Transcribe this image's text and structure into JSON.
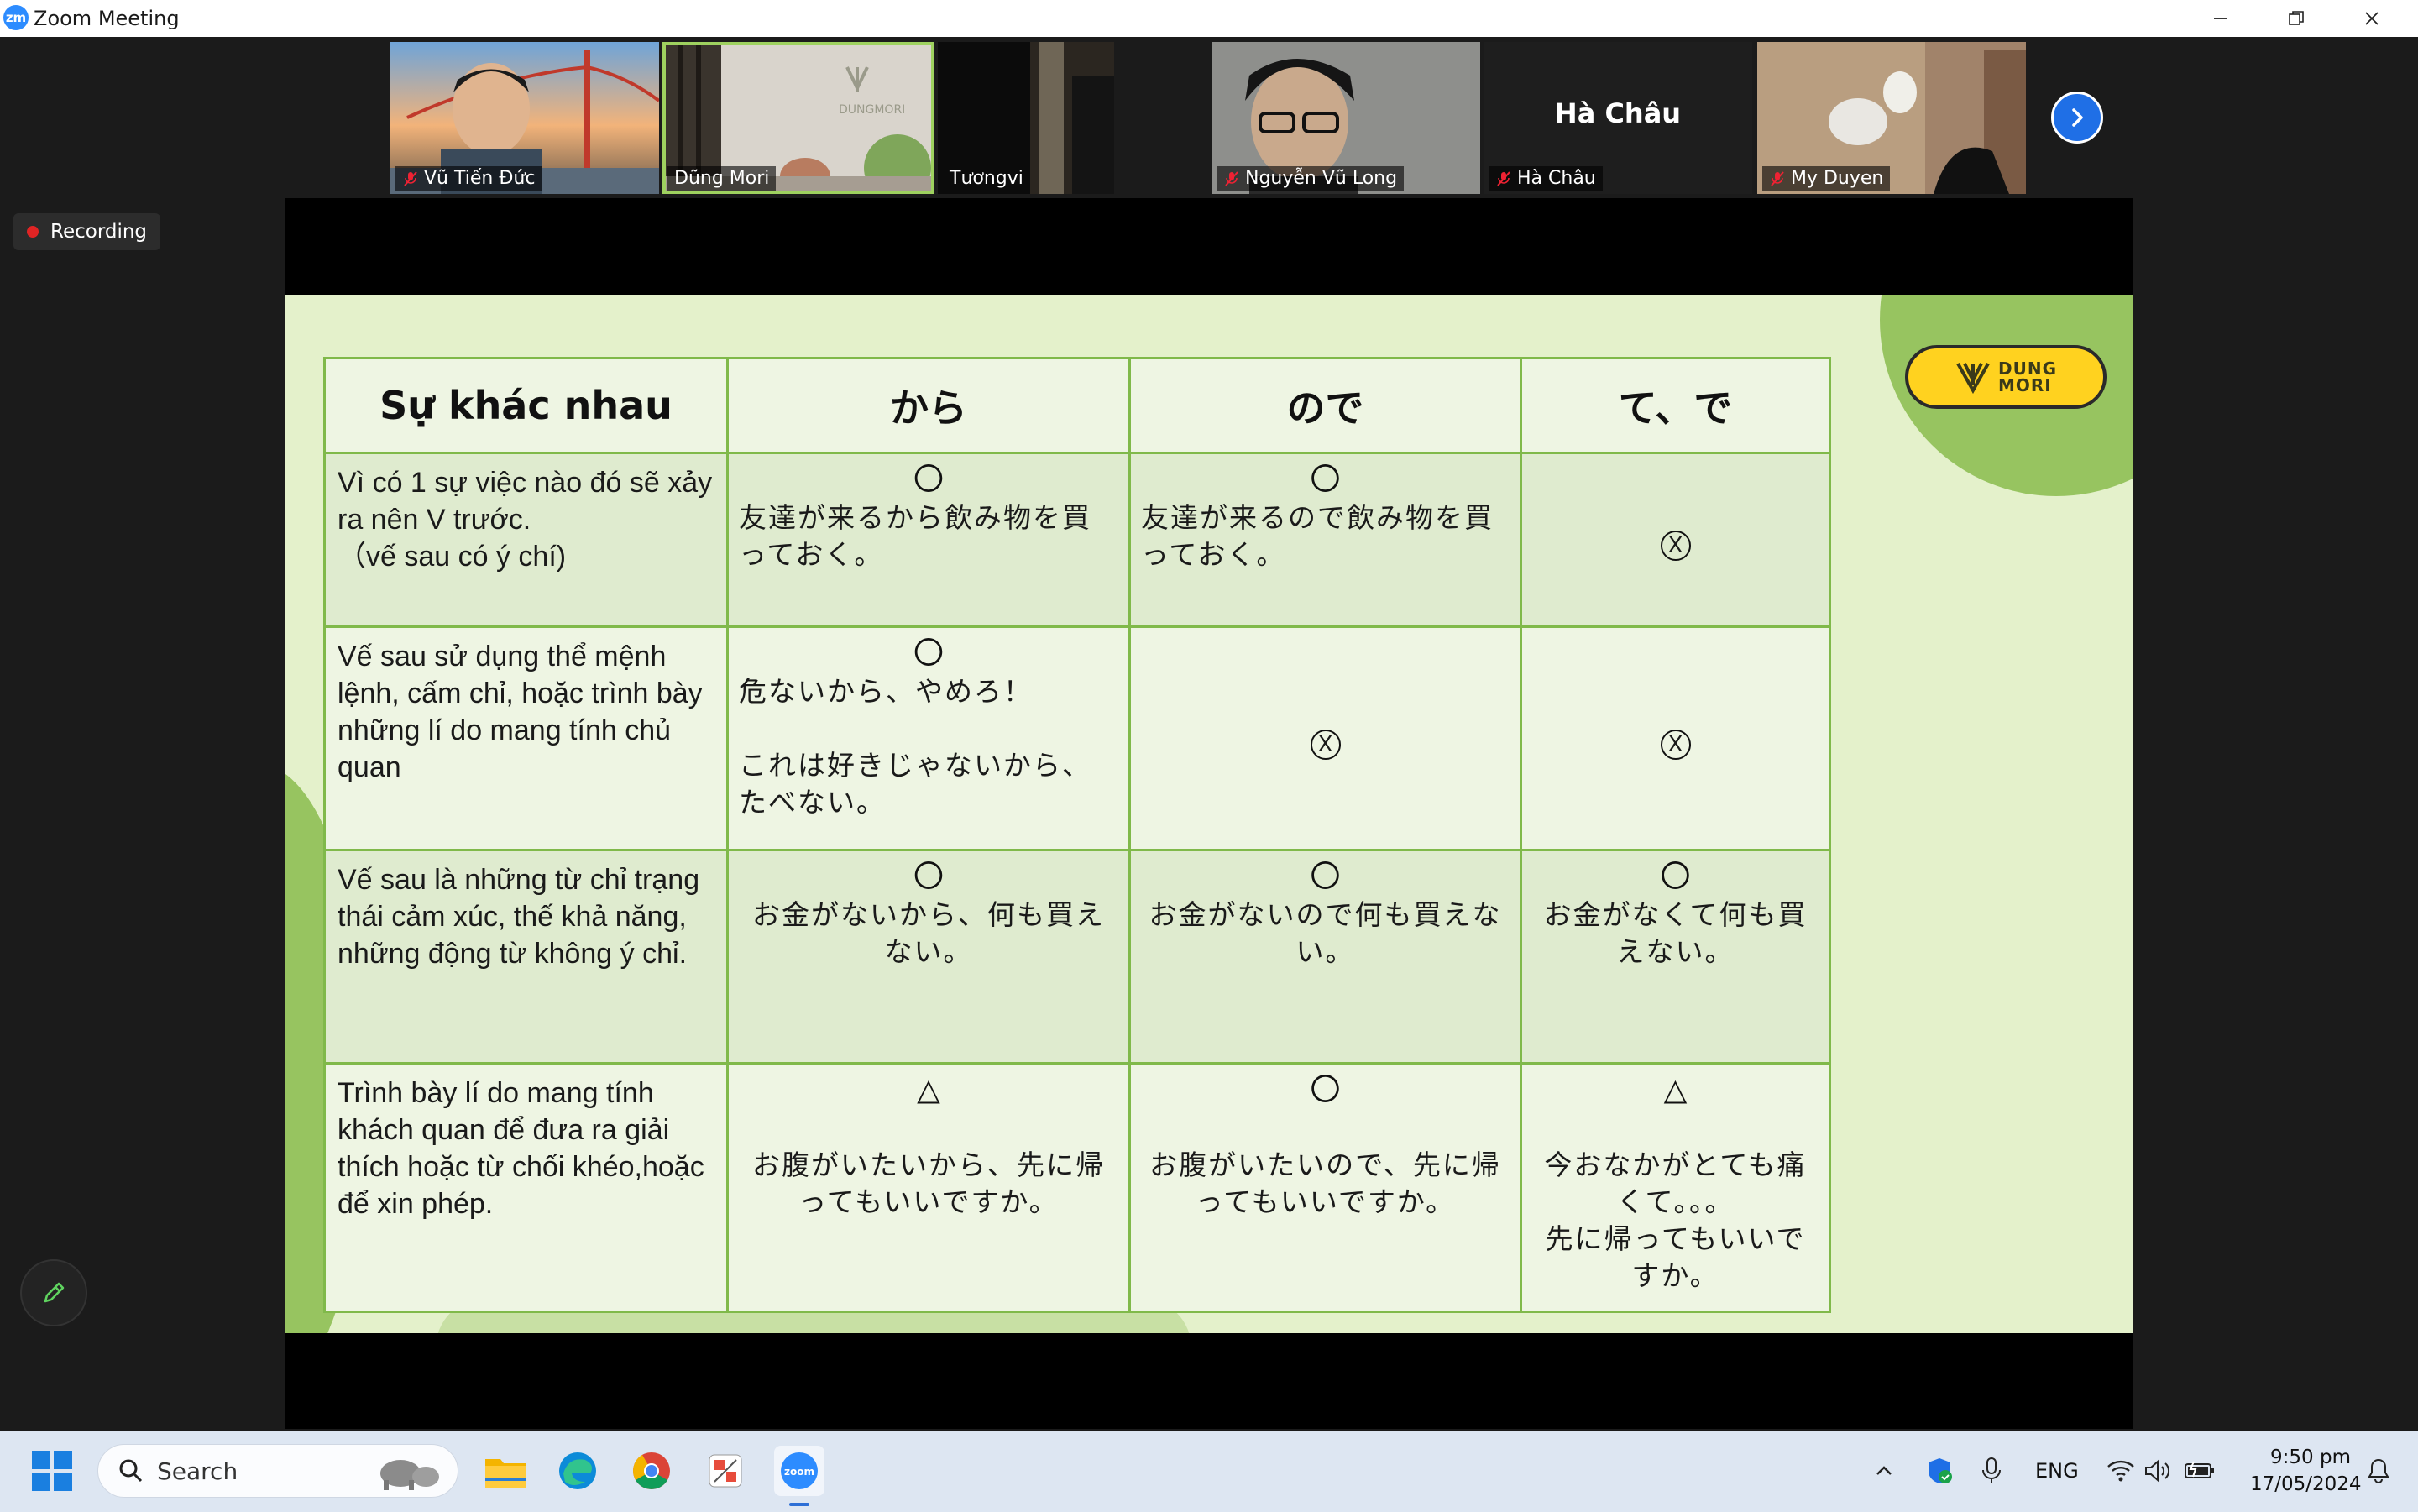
{
  "window": {
    "title": "Zoom Meeting",
    "logo_text": "zm"
  },
  "participants": [
    {
      "name": "Vũ Tiến Đức",
      "muted": true
    },
    {
      "name": "Dũng Mori",
      "muted": false,
      "active": true
    },
    {
      "name": "Tươngvi",
      "muted": false
    },
    {
      "name": "Nguyễn Vũ Long",
      "muted": true
    },
    {
      "name": "Hà Châu",
      "muted": true,
      "display_name_large": "Hà Châu"
    },
    {
      "name": "My Duyen",
      "muted": true
    }
  ],
  "recording": {
    "label": "Recording"
  },
  "slide": {
    "logo_line1": "DUNG",
    "logo_line2": "MORI",
    "headers": [
      "Sự khác nhau",
      "から",
      "ので",
      "て、で"
    ],
    "rows": [
      {
        "criterion": "Vì có 1 sự việc nào đó sẽ xảy ra nên V trước.\n（vế sau có ý chí)",
        "kara": {
          "symbol": "〇",
          "text": "友達が来るから飲み物を買っておく。"
        },
        "node": {
          "symbol": "〇",
          "text": "友達が来るので飲み物を買っておく。"
        },
        "te": {
          "symbol": "X",
          "text": ""
        }
      },
      {
        "criterion": "Vế sau sử dụng thể mệnh lệnh, cấm chỉ, hoặc trình bày những lí do mang tính chủ quan",
        "kara": {
          "symbol": "〇",
          "text": "危ないから、やめろ！\n\nこれは好きじゃないから、たべない。"
        },
        "node": {
          "symbol": "X",
          "text": ""
        },
        "te": {
          "symbol": "X",
          "text": ""
        }
      },
      {
        "criterion": "Vế sau là những từ chỉ trạng thái cảm xúc, thế khả năng, những động từ không ý chỉ.",
        "kara": {
          "symbol": "〇",
          "text": "お金がないから、何も買えない。"
        },
        "node": {
          "symbol": "〇",
          "text": "お金がないので何も買えない。"
        },
        "te": {
          "symbol": "〇",
          "text": "お金がなくて何も買えない。"
        }
      },
      {
        "criterion": "Trình bày lí do mang tính khách quan để đưa ra giải thích hoặc từ chối khéo,hoặc để xin phép.",
        "kara": {
          "symbol": "△",
          "text": "\nお腹がいたいから、先に帰ってもいいですか。"
        },
        "node": {
          "symbol": "〇",
          "text": "\nお腹がいたいので、先に帰ってもいいですか。"
        },
        "te": {
          "symbol": "△",
          "text": "\n今おなかがとても痛くて。。。\n先に帰ってもいいですか。"
        }
      }
    ]
  },
  "taskbar": {
    "search_placeholder": "Search",
    "language": "ENG",
    "time": "9:50 pm",
    "date": "17/05/2024"
  }
}
